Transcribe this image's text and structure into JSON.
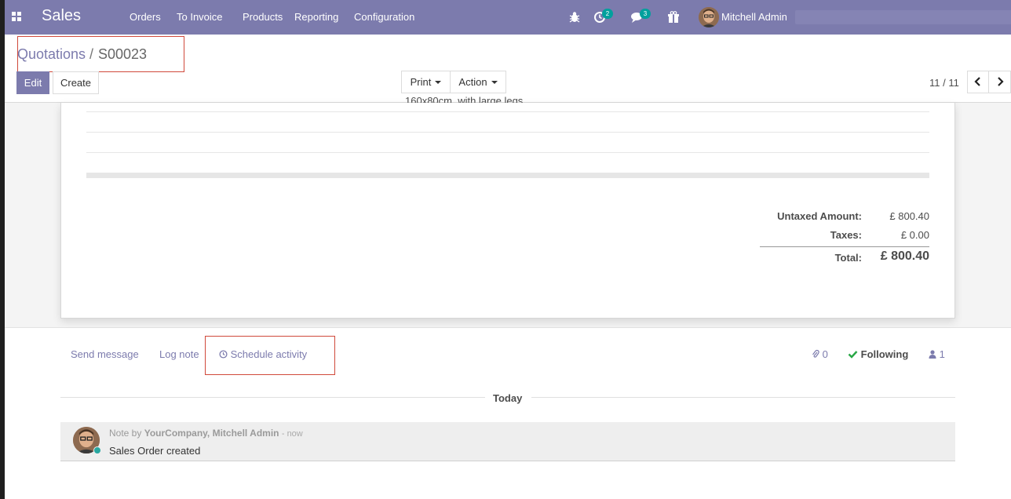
{
  "navbar": {
    "brand": "Sales",
    "menu": [
      "Orders",
      "To Invoice",
      "Products",
      "Reporting",
      "Configuration"
    ],
    "activity_badge": "2",
    "messages_badge": "3",
    "user_name": "Mitchell Admin"
  },
  "breadcrumb": {
    "parent": "Quotations",
    "separator": "/",
    "current": "S00023"
  },
  "buttons": {
    "edit": "Edit",
    "create": "Create",
    "print": "Print",
    "action": "Action"
  },
  "pager": {
    "value": "11 / 11"
  },
  "sheet": {
    "line_description": "160x80cm, with large legs.",
    "totals": {
      "untaxed_label": "Untaxed Amount:",
      "untaxed_value": "£ 800.40",
      "taxes_label": "Taxes:",
      "taxes_value": "£ 0.00",
      "total_label": "Total:",
      "total_value": "£ 800.40"
    }
  },
  "chatter": {
    "send_message": "Send message",
    "log_note": "Log note",
    "schedule_activity": "Schedule activity",
    "attachments_count": "0",
    "following_label": "Following",
    "followers_count": "1",
    "day_separator": "Today",
    "message": {
      "prefix": "Note by",
      "author": "YourCompany, Mitchell Admin",
      "time": "- now",
      "body": "Sales Order created"
    }
  },
  "colors": {
    "brand": "#7c7bad",
    "highlight": "#d0493b",
    "following_check": "#28a745",
    "badge": "#00a09d"
  }
}
